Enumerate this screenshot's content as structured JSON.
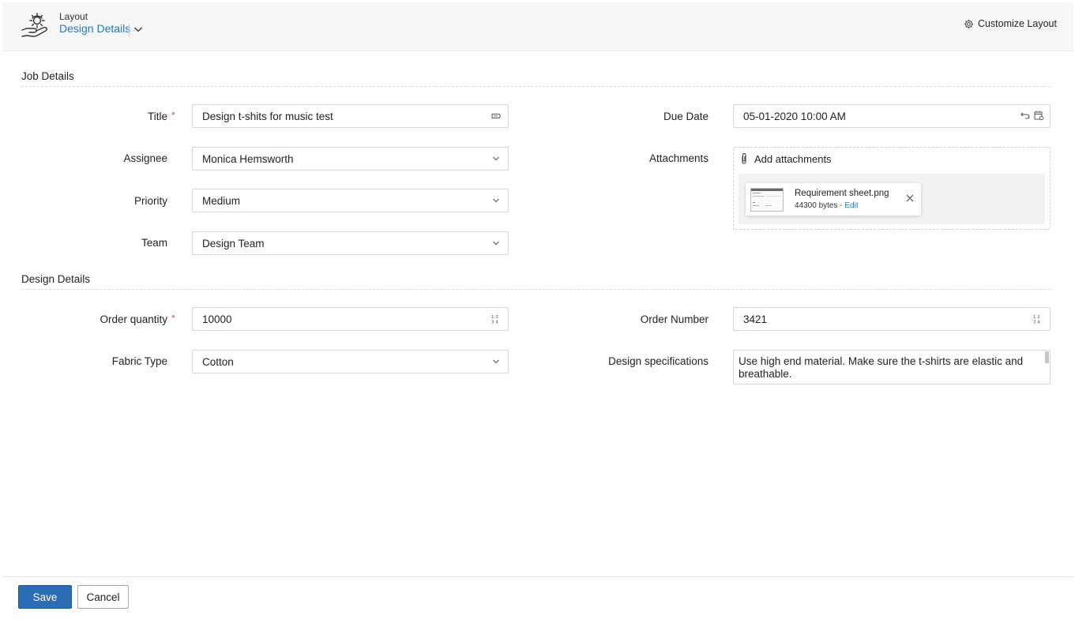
{
  "header": {
    "layout_label": "Layout",
    "layout_name": "Design Details",
    "customize_label": "Customize Layout"
  },
  "sections": {
    "job_details": "Job Details",
    "design_details": "Design Details"
  },
  "job": {
    "title": {
      "label": "Title",
      "value": "Design t-shits for music test",
      "required_mark": "*"
    },
    "assignee": {
      "label": "Assignee",
      "value": "Monica Hemsworth"
    },
    "priority": {
      "label": "Priority",
      "value": "Medium"
    },
    "team": {
      "label": "Team",
      "value": "Design Team"
    },
    "due_date": {
      "label": "Due Date",
      "value": "05-01-2020 10:00 AM"
    },
    "attachments": {
      "label": "Attachments",
      "add_label": "Add attachments",
      "file_name": "Requirement sheet.png",
      "file_size": "44300 bytes",
      "edit_label": "- Edit"
    }
  },
  "design": {
    "order_quantity": {
      "label": "Order quantity",
      "value": "10000",
      "required_mark": "*"
    },
    "fabric_type": {
      "label": "Fabric Type",
      "value": "Cotton"
    },
    "order_number": {
      "label": "Order Number",
      "value": "3421"
    },
    "specifications": {
      "label": "Design specifications",
      "value": "Use high end material. Make sure the t-shirts are elastic and breathable."
    }
  },
  "footer": {
    "save_label": "Save",
    "cancel_label": "Cancel"
  },
  "colors": {
    "accent": "#2a78b8",
    "save_button": "#2a6db5",
    "required": "#e0474c",
    "header_bg": "#f6f6f6"
  },
  "icons": {
    "logo": "hand-gear-icon",
    "customize": "gear-icon",
    "dropdown": "chevron-down-icon",
    "title_field": "tag-icon",
    "due_date": [
      "reset-icon",
      "calendar-icon"
    ],
    "number_field": "number-icon",
    "attachment": "paperclip-icon",
    "remove_file": "close-icon"
  }
}
